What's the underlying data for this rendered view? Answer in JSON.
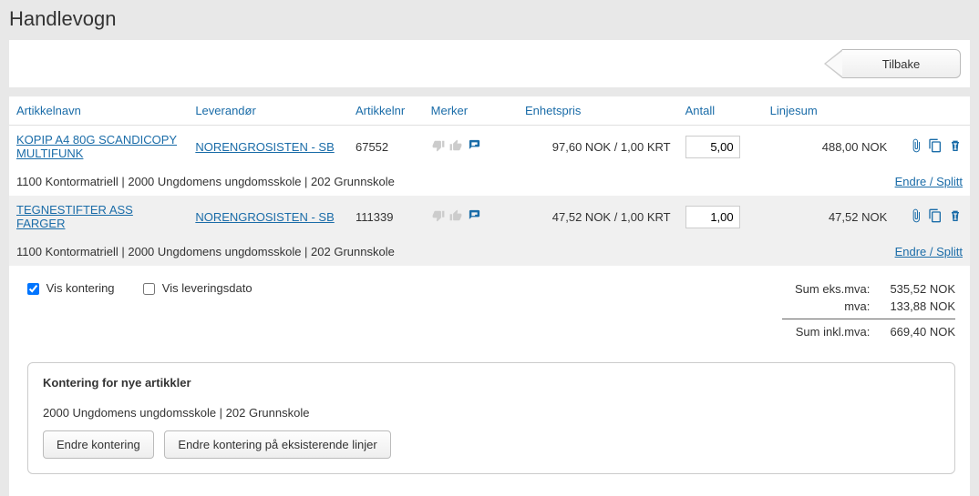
{
  "page_title": "Handlevogn",
  "back_button": "Tilbake",
  "columns": {
    "name": "Artikkelnavn",
    "supplier": "Leverandør",
    "article_no": "Artikkelnr",
    "tags": "Merker",
    "unit_price": "Enhetspris",
    "qty": "Antall",
    "line_sum": "Linjesum"
  },
  "rows": [
    {
      "name": "KOPIP A4 80G SCANDICOPY MULTIFUNK",
      "supplier": "NORENGROSISTEN - SB",
      "article_no": "67552",
      "unit_price": "97,60 NOK / 1,00 KRT",
      "qty": "5,00",
      "line_sum": "488,00 NOK",
      "accounting": "1100 Kontormatriell | 2000 Ungdomens ungdomsskole | 202 Grunnskole",
      "edit_split": "Endre / Splitt"
    },
    {
      "name": "TEGNESTIFTER ASS FARGER",
      "supplier": "NORENGROSISTEN - SB",
      "article_no": "111339",
      "unit_price": "47,52 NOK / 1,00 KRT",
      "qty": "1,00",
      "line_sum": "47,52 NOK",
      "accounting": "1100 Kontormatriell | 2000 Ungdomens ungdomsskole | 202 Grunnskole",
      "edit_split": "Endre / Splitt"
    }
  ],
  "options": {
    "show_accounting": "Vis kontering",
    "show_delivery_date": "Vis leveringsdato"
  },
  "totals": {
    "ex_vat_label": "Sum eks.mva:",
    "ex_vat": "535,52 NOK",
    "vat_label": "mva:",
    "vat": "133,88 NOK",
    "incl_vat_label": "Sum inkl.mva:",
    "incl_vat": "669,40 NOK"
  },
  "kontering_box": {
    "title": "Kontering for nye artikkler",
    "accounting": "2000 Ungdomens ungdomsskole | 202 Grunnskole",
    "btn_change": "Endre kontering",
    "btn_change_existing": "Endre kontering på eksisterende linjer"
  }
}
